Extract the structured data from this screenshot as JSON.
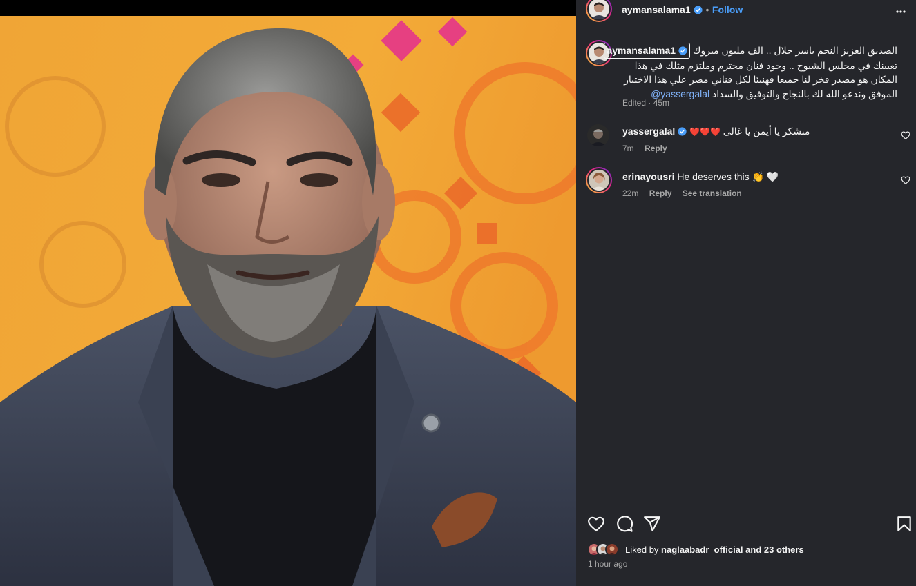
{
  "post": {
    "author": "aymansalama1",
    "follow_label": "Follow",
    "separator": "•",
    "more_icon": "more-horizontal-icon",
    "verified_icon": "verified-badge-icon",
    "accent_color": "#4a9df8"
  },
  "caption": {
    "author": "aymansalama1",
    "line1": "الصديق العزيز النجم ياسر جلال .. الف مليون مبروك",
    "line2": "تعيينك في مجلس الشيوخ .. وجود فنان محترم وملتزم مثلك في هذا",
    "line3": "المكان هو مصدر فخر لنا جميعا فهنيئا لكل فناني مصر علي هذا الاختيار",
    "line4_mention": "@yassergalal",
    "line4_text": "الموفق وندعو الله لك بالنجاح والتوفيق والسداد",
    "meta": "Edited · 45m"
  },
  "comments": [
    {
      "username": "yassergalal",
      "verified": true,
      "text": "متشكر يا أيمن يا غالى",
      "emoji": "❤️❤️❤️",
      "time": "7m",
      "reply_label": "Reply"
    },
    {
      "username": "erinayousri",
      "verified": false,
      "text": "He deserves this 👏 🤍",
      "time": "22m",
      "reply_label": "Reply",
      "translation_label": "See translation"
    }
  ],
  "actions": {
    "like_icon": "heart-icon",
    "comment_icon": "comment-icon",
    "share_icon": "share-icon",
    "save_icon": "bookmark-icon"
  },
  "likes": {
    "prefix": "Liked by",
    "user": "naglaabadr_official",
    "suffix": "and 23 others"
  },
  "timestamp": "1 hour ago"
}
